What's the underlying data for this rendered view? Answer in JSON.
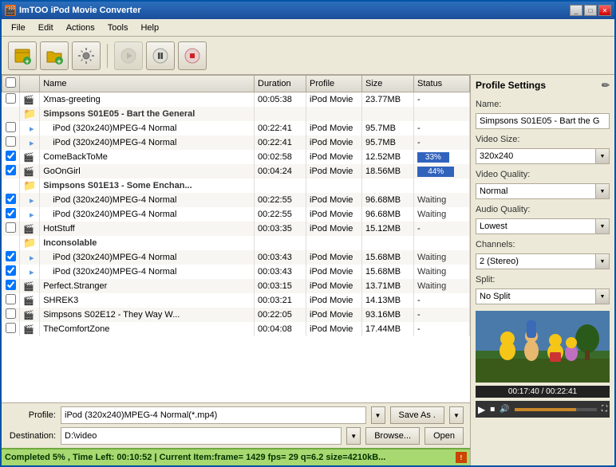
{
  "window": {
    "title": "ImTOO iPod Movie Converter"
  },
  "menu": {
    "items": [
      "File",
      "Edit",
      "Actions",
      "Tools",
      "Help"
    ]
  },
  "toolbar": {
    "buttons": [
      {
        "name": "add-files-btn",
        "icon": "📂",
        "label": "Add Files"
      },
      {
        "name": "add-folder-btn",
        "icon": "📁",
        "label": "Add Folder"
      },
      {
        "name": "settings-btn",
        "icon": "⚙",
        "label": "Settings"
      },
      {
        "name": "play-btn",
        "icon": "▶",
        "label": "Play",
        "disabled": true
      },
      {
        "name": "pause-btn",
        "icon": "⏸",
        "label": "Pause"
      },
      {
        "name": "stop-btn",
        "icon": "⏹",
        "label": "Stop"
      }
    ]
  },
  "table": {
    "headers": [
      "",
      "",
      "Name",
      "Duration",
      "Profile",
      "Size",
      "Status"
    ],
    "rows": [
      {
        "checked": false,
        "indent": 0,
        "type": "file",
        "name": "Xmas-greeting",
        "duration": "00:05:38",
        "profile": "iPod Movie",
        "size": "23.77MB",
        "status": "-"
      },
      {
        "checked": false,
        "indent": 0,
        "type": "folder",
        "name": "Simpsons S01E05 - Bart the General",
        "duration": "",
        "profile": "",
        "size": "",
        "status": ""
      },
      {
        "checked": false,
        "indent": 1,
        "type": "sub",
        "name": "iPod (320x240)MPEG-4 Normal",
        "duration": "00:22:41",
        "profile": "iPod Movie",
        "size": "95.7MB",
        "status": "-"
      },
      {
        "checked": false,
        "indent": 1,
        "type": "sub",
        "name": "iPod (320x240)MPEG-4 Normal",
        "duration": "00:22:41",
        "profile": "iPod Movie",
        "size": "95.7MB",
        "status": "-"
      },
      {
        "checked": true,
        "indent": 0,
        "type": "file",
        "name": "ComeBackToMe",
        "duration": "00:02:58",
        "profile": "iPod Movie",
        "size": "12.52MB",
        "status": "33%",
        "isProgress": true,
        "progress": 33
      },
      {
        "checked": true,
        "indent": 0,
        "type": "file",
        "name": "GoOnGirl",
        "duration": "00:04:24",
        "profile": "iPod Movie",
        "size": "18.56MB",
        "status": "44%",
        "isProgress": true,
        "progress": 44
      },
      {
        "checked": false,
        "indent": 0,
        "type": "folder",
        "name": "Simpsons S01E13 - Some Enchan...",
        "duration": "",
        "profile": "",
        "size": "",
        "status": ""
      },
      {
        "checked": true,
        "indent": 1,
        "type": "sub",
        "name": "iPod (320x240)MPEG-4 Normal",
        "duration": "00:22:55",
        "profile": "iPod Movie",
        "size": "96.68MB",
        "status": "Waiting"
      },
      {
        "checked": true,
        "indent": 1,
        "type": "sub",
        "name": "iPod (320x240)MPEG-4 Normal",
        "duration": "00:22:55",
        "profile": "iPod Movie",
        "size": "96.68MB",
        "status": "Waiting"
      },
      {
        "checked": false,
        "indent": 0,
        "type": "file",
        "name": "HotStuff",
        "duration": "00:03:35",
        "profile": "iPod Movie",
        "size": "15.12MB",
        "status": "-"
      },
      {
        "checked": false,
        "indent": 0,
        "type": "folder",
        "name": "Inconsolable",
        "duration": "",
        "profile": "",
        "size": "",
        "status": ""
      },
      {
        "checked": true,
        "indent": 1,
        "type": "sub",
        "name": "iPod (320x240)MPEG-4 Normal",
        "duration": "00:03:43",
        "profile": "iPod Movie",
        "size": "15.68MB",
        "status": "Waiting"
      },
      {
        "checked": true,
        "indent": 1,
        "type": "sub",
        "name": "iPod (320x240)MPEG-4 Normal",
        "duration": "00:03:43",
        "profile": "iPod Movie",
        "size": "15.68MB",
        "status": "Waiting"
      },
      {
        "checked": true,
        "indent": 0,
        "type": "file",
        "name": "Perfect.Stranger",
        "duration": "00:03:15",
        "profile": "iPod Movie",
        "size": "13.71MB",
        "status": "Waiting"
      },
      {
        "checked": false,
        "indent": 0,
        "type": "file",
        "name": "SHREK3",
        "duration": "00:03:21",
        "profile": "iPod Movie",
        "size": "14.13MB",
        "status": "-"
      },
      {
        "checked": false,
        "indent": 0,
        "type": "file",
        "name": "Simpsons S02E12 - They Way W...",
        "duration": "00:22:05",
        "profile": "iPod Movie",
        "size": "93.16MB",
        "status": "-"
      },
      {
        "checked": false,
        "indent": 0,
        "type": "file",
        "name": "TheComfortZone",
        "duration": "00:04:08",
        "profile": "iPod Movie",
        "size": "17.44MB",
        "status": "-"
      }
    ]
  },
  "profile_panel": {
    "title": "Profile Settings",
    "name_label": "Name:",
    "name_value": "Simpsons S01E05 - Bart the G",
    "video_size_label": "Video Size:",
    "video_size_value": "320x240",
    "video_quality_label": "Video Quality:",
    "video_quality_value": "Normal",
    "audio_quality_label": "Audio Quality:",
    "audio_quality_value": "Lowest",
    "channels_label": "Channels:",
    "channels_value": "2 (Stereo)",
    "split_label": "Split:",
    "split_value": "No Split",
    "time_current": "00:17:40",
    "time_total": "00:22:41",
    "time_display": "00:17:40 / 00:22:41"
  },
  "bottom": {
    "profile_label": "Profile:",
    "profile_value": "iPod (320x240)MPEG-4 Normal(*.mp4)",
    "save_as_label": "Save As .",
    "destination_label": "Destination:",
    "destination_value": "D:\\video",
    "browse_label": "Browse...",
    "open_label": "Open"
  },
  "statusbar": {
    "text": "Completed 5% , Time Left: 00:10:52 | Current Item:frame= 1429 fps= 29 q=6.2 size=4210kB..."
  }
}
